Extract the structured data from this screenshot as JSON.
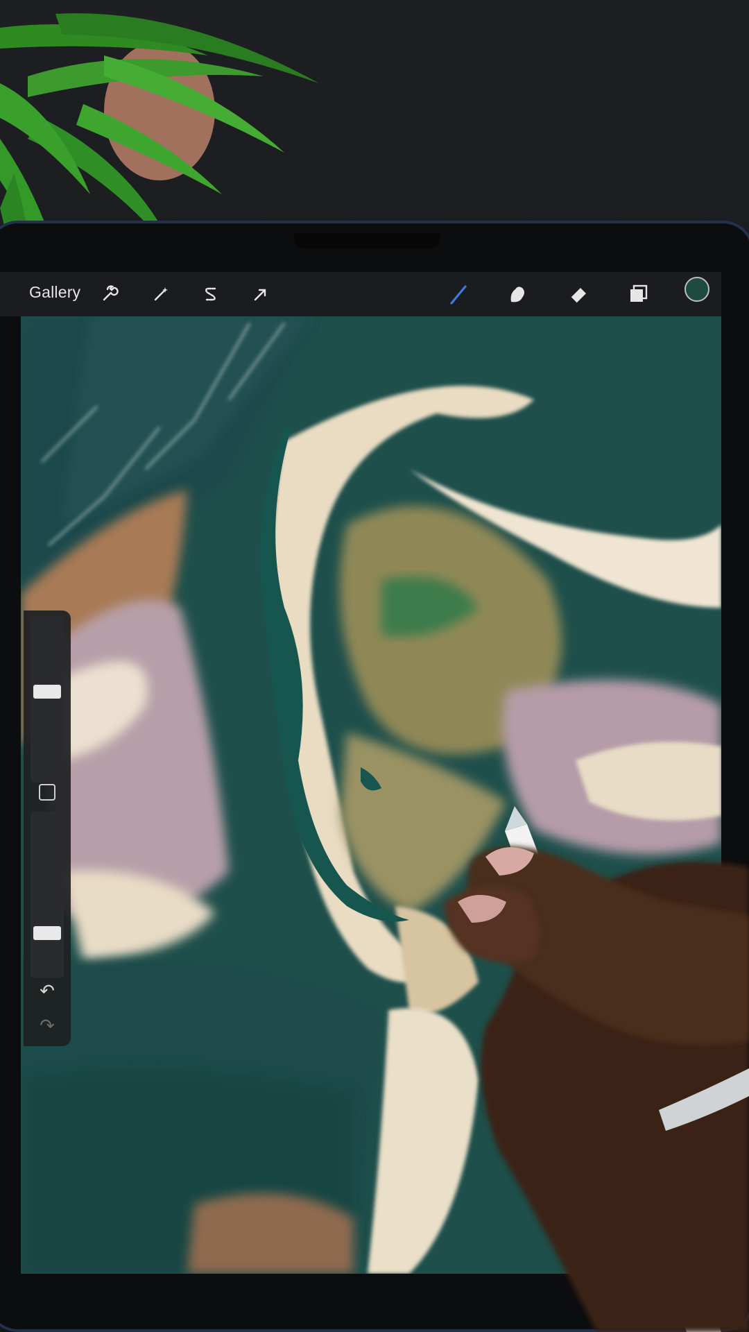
{
  "toolbar": {
    "gallery_label": "Gallery",
    "left_tools": [
      {
        "name": "actions",
        "icon": "wrench-icon"
      },
      {
        "name": "adjustments",
        "icon": "magic-wand-icon"
      },
      {
        "name": "selection",
        "icon": "selection-s-icon"
      },
      {
        "name": "transform",
        "icon": "arrow-cursor-icon"
      }
    ],
    "right_tools": [
      {
        "name": "brush",
        "icon": "brush-icon",
        "active": true
      },
      {
        "name": "smudge",
        "icon": "smudge-finger-icon"
      },
      {
        "name": "eraser",
        "icon": "eraser-icon"
      },
      {
        "name": "layers",
        "icon": "layers-icon"
      }
    ],
    "active_color": "#1f4a40",
    "accent_color": "#3a7be0"
  },
  "sidebar": {
    "brush_size_level": 0.55,
    "opacity_level": 0.25,
    "modify_icon": "square-icon",
    "undo_icon": "undo-arrow-icon",
    "redo_icon": "redo-arrow-icon"
  },
  "canvas": {
    "colors": {
      "teal": "#1f5c57",
      "deep_teal": "#123f3c",
      "sand": "#d9c6a8",
      "cream": "#efe6d4",
      "mauve": "#b39aa6",
      "brown": "#a9784f",
      "olive": "#7f7c4a"
    }
  }
}
